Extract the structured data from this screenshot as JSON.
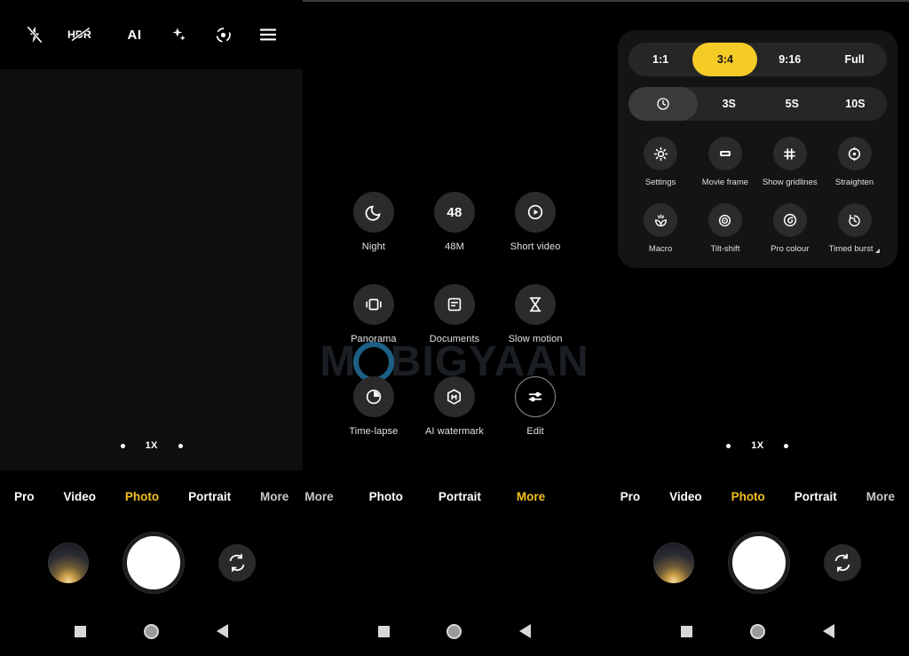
{
  "app": {
    "name": "Camera",
    "accent_yellow": "#f2c01e",
    "sheet_yellow": "#f5cb26",
    "background": "#000000",
    "watermark": {
      "text": "MOBIGYAAN",
      "pre": "M",
      "highlight": "O",
      "post": "BIGYAAN",
      "color": "#1b1f24",
      "ring_color": "#1d5f86"
    }
  },
  "topbar": {
    "icons": [
      {
        "name": "flash-off-icon",
        "label": "Flash off"
      },
      {
        "name": "hdr-off-icon",
        "label": "HDR",
        "text": "HDR"
      },
      {
        "name": "ai-icon",
        "label": "AI",
        "text": "AI"
      },
      {
        "name": "magic-sparkle-icon",
        "label": "Magic"
      },
      {
        "name": "google-lens-icon",
        "label": "Lens"
      },
      {
        "name": "menu-icon",
        "label": "Menu"
      }
    ]
  },
  "zoom_control": {
    "left_dot": "",
    "current": "1X",
    "right_dot": ""
  },
  "mode_strip": {
    "panel_left": [
      {
        "label": "Pro",
        "active": false
      },
      {
        "label": "Video",
        "active": false
      },
      {
        "label": "Photo",
        "active": true
      },
      {
        "label": "Portrait",
        "active": false
      },
      {
        "label": "More",
        "active": false
      }
    ],
    "panel_mid": [
      {
        "label": "Photo",
        "active": false
      },
      {
        "label": "Portrait",
        "active": false
      },
      {
        "label": "More",
        "active": true
      }
    ],
    "panel_mid_overflow": "More",
    "panel_right": [
      {
        "label": "Pro",
        "active": false
      },
      {
        "label": "Video",
        "active": false
      },
      {
        "label": "Photo",
        "active": true
      },
      {
        "label": "Portrait",
        "active": false
      },
      {
        "label": "More",
        "active": false
      }
    ]
  },
  "shutter_row": {
    "thumbnail_label": "Last photo thumbnail",
    "shutter_label": "Shutter",
    "flip_label": "Switch camera"
  },
  "navbar": {
    "recents": "Recents",
    "home": "Home",
    "back": "Back"
  },
  "more_modes": {
    "items": [
      {
        "label": "Night",
        "icon": "moon-icon",
        "text": ""
      },
      {
        "label": "48M",
        "icon": "megapixel-icon",
        "text": "48"
      },
      {
        "label": "Short video",
        "icon": "play-circle-icon",
        "text": ""
      },
      {
        "label": "Panorama",
        "icon": "panorama-icon",
        "text": ""
      },
      {
        "label": "Documents",
        "icon": "document-icon",
        "text": ""
      },
      {
        "label": "Slow motion",
        "icon": "hourglass-icon",
        "text": ""
      },
      {
        "label": "Time-lapse",
        "icon": "timelapse-icon",
        "text": ""
      },
      {
        "label": "AI watermark",
        "icon": "ai-watermark-icon",
        "text": ""
      },
      {
        "label": "Edit",
        "icon": "sliders-icon",
        "text": ""
      }
    ]
  },
  "settings_sheet": {
    "aspect_ratio": {
      "options": [
        "1:1",
        "3:4",
        "9:16",
        "Full"
      ],
      "selected": "3:4"
    },
    "timer": {
      "options": [
        "timer-off-icon",
        "3S",
        "5S",
        "10S"
      ],
      "selected": "timer-off-icon",
      "selected_index": 0
    },
    "tools": [
      {
        "label": "Settings",
        "icon": "gear-icon"
      },
      {
        "label": "Movie frame",
        "icon": "movie-frame-icon"
      },
      {
        "label": "Show gridlines",
        "icon": "grid-icon"
      },
      {
        "label": "Straighten",
        "icon": "straighten-icon"
      },
      {
        "label": "Macro",
        "icon": "macro-flower-icon"
      },
      {
        "label": "Tilt-shift",
        "icon": "tilt-shift-icon"
      },
      {
        "label": "Pro colour",
        "icon": "pro-colour-icon"
      },
      {
        "label": "Timed burst",
        "icon": "timed-burst-icon",
        "has_corner": true
      }
    ]
  }
}
